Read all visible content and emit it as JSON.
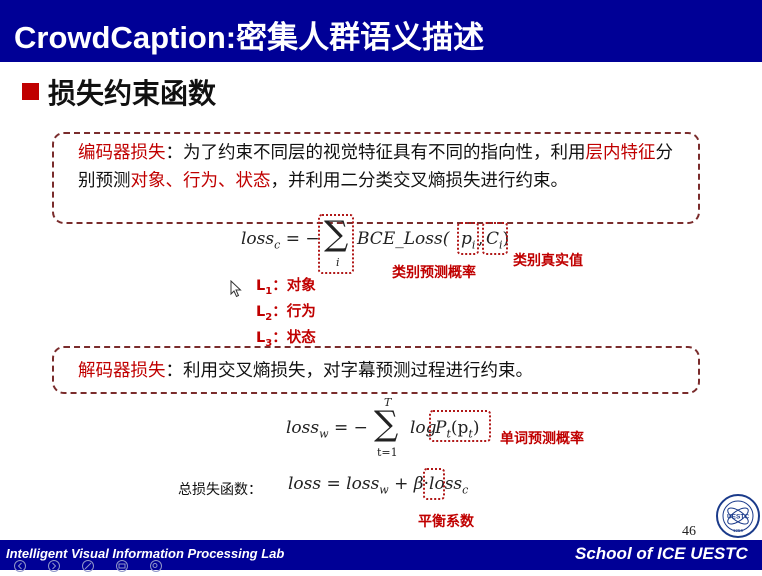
{
  "slide": {
    "title": "CrowdCaption:密集人群语义描述",
    "heading": "损失约束函数",
    "page_number": "46"
  },
  "box1": {
    "s1": "编码器损失",
    "s2": "：为了约束不同层的视觉特征具有不同的指向性，利用",
    "s3": "层内特征",
    "s4": "分别预测",
    "s5": "对象、行为、状态",
    "s6": "，并利用二分类交叉熵损失进行约束。"
  },
  "box2": {
    "s1": "解码器损失",
    "s2": "：利用交叉熵损失，对字幕预测过程进行约束。"
  },
  "eq1": {
    "lhs": "loss",
    "lhs_sub": "c",
    "eq": " = −",
    "sum_sub": "i",
    "func": "BCE_Loss(",
    "p": "p",
    "p_sub": "i",
    "comma": ", ",
    "c": "C",
    "c_sub": "i",
    "close": ")"
  },
  "eq2": {
    "lhs": "loss",
    "lhs_sub": "w",
    "eq": " = −",
    "sum_top": "T",
    "sum_sub": "t=1",
    "log": "log",
    "pt": "P",
    "pt_sub": "t",
    "arg": "(p",
    "arg_sub": "t",
    "close": ")"
  },
  "eq3": {
    "label": "总损失函数：",
    "lhs": "loss = loss",
    "lhs_sub": "w",
    "plus": " + ",
    "beta": "β",
    "dot": "·",
    "lossc": "loss",
    "lossc_sub": "c"
  },
  "annotations": {
    "prob": "类别预测概率",
    "truth": "类别真实值",
    "word_prob": "单词预测概率",
    "balance": "平衡系数"
  },
  "levels": [
    {
      "L": "L",
      "sub": "1",
      "text": "：对象"
    },
    {
      "L": "L",
      "sub": "2",
      "text": "：行为"
    },
    {
      "L": "L",
      "sub": "3",
      "text": "：状态"
    }
  ],
  "footer": {
    "lab": "Intelligent Visual Information Processing Lab",
    "school": "School of ICE   UESTC",
    "logo_text": "UESTC",
    "logo_year": "1956"
  },
  "colors": {
    "title_bar": "#000096",
    "accent_red": "#c00000",
    "box_border": "#7a2c2c"
  }
}
